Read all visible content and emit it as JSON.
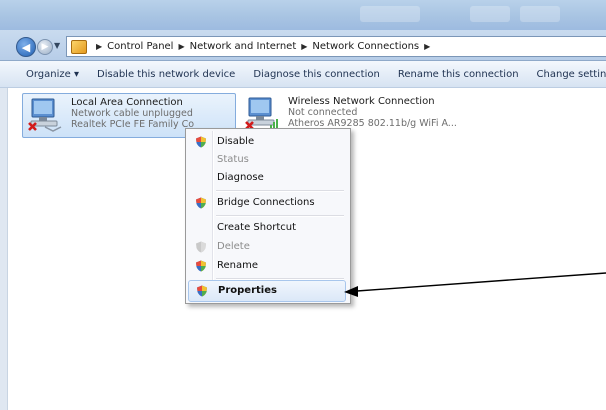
{
  "address_bar": {
    "crumbs": [
      "Control Panel",
      "Network and Internet",
      "Network Connections"
    ]
  },
  "toolbar": {
    "items": [
      "Organize ▾",
      "Disable this network device",
      "Diagnose this connection",
      "Rename this connection",
      "Change settings of t"
    ]
  },
  "connections": [
    {
      "name": "Local Area Connection",
      "status": "Network cable unplugged",
      "device": "Realtek PCIe FE Family Co",
      "disconnected": true
    },
    {
      "name": "Wireless Network Connection",
      "status": "Not connected",
      "device": "Atheros AR9285 802.11b/g WiFi A...",
      "disconnected": true
    }
  ],
  "context_menu": {
    "items": [
      {
        "label": "Disable",
        "icon": "shield-icon",
        "bold": false,
        "disabled": false
      },
      {
        "label": "Status",
        "icon": "",
        "bold": false,
        "disabled": true
      },
      {
        "label": "Diagnose",
        "icon": "",
        "bold": false,
        "disabled": false
      },
      {
        "label": "Bridge Connections",
        "icon": "shield-icon",
        "bold": false,
        "disabled": false
      },
      {
        "label": "Create Shortcut",
        "icon": "",
        "bold": false,
        "disabled": false
      },
      {
        "label": "Delete",
        "icon": "shield-icon",
        "bold": false,
        "disabled": true
      },
      {
        "label": "Rename",
        "icon": "shield-icon",
        "bold": false,
        "disabled": false
      },
      {
        "label": "Properties",
        "icon": "shield-icon",
        "bold": true,
        "disabled": false,
        "highlighted": true
      }
    ]
  },
  "colors": {
    "accent": "#3a78c2",
    "selection": "#cde2f8",
    "disabled_text": "#8c8c8c"
  }
}
